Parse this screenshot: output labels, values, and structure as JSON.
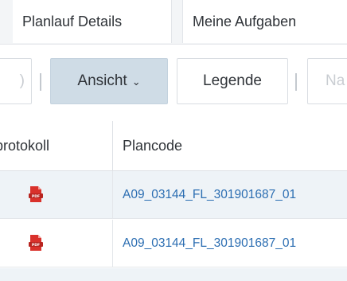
{
  "tabs": [
    {
      "label": "Planlauf Details"
    },
    {
      "label": "Meine Aufgaben"
    }
  ],
  "toolbar": {
    "partial_left_label": ")",
    "view_label": "Ansicht",
    "view_chevron": "⌄",
    "legend_label": "Legende",
    "partial_right_label": "Na"
  },
  "table": {
    "columns": [
      "protokoll",
      "Plancode"
    ],
    "rows": [
      {
        "icon": "pdf-icon",
        "plancode": "A09_03144_FL_301901687_01"
      },
      {
        "icon": "pdf-icon",
        "plancode": "A09_03144_FL_301901687_01"
      }
    ]
  },
  "colors": {
    "accent_button": "#cfdce6",
    "link": "#2c6eb2",
    "row_stripe": "#eef3f7",
    "pdf_red": "#d9312b"
  }
}
